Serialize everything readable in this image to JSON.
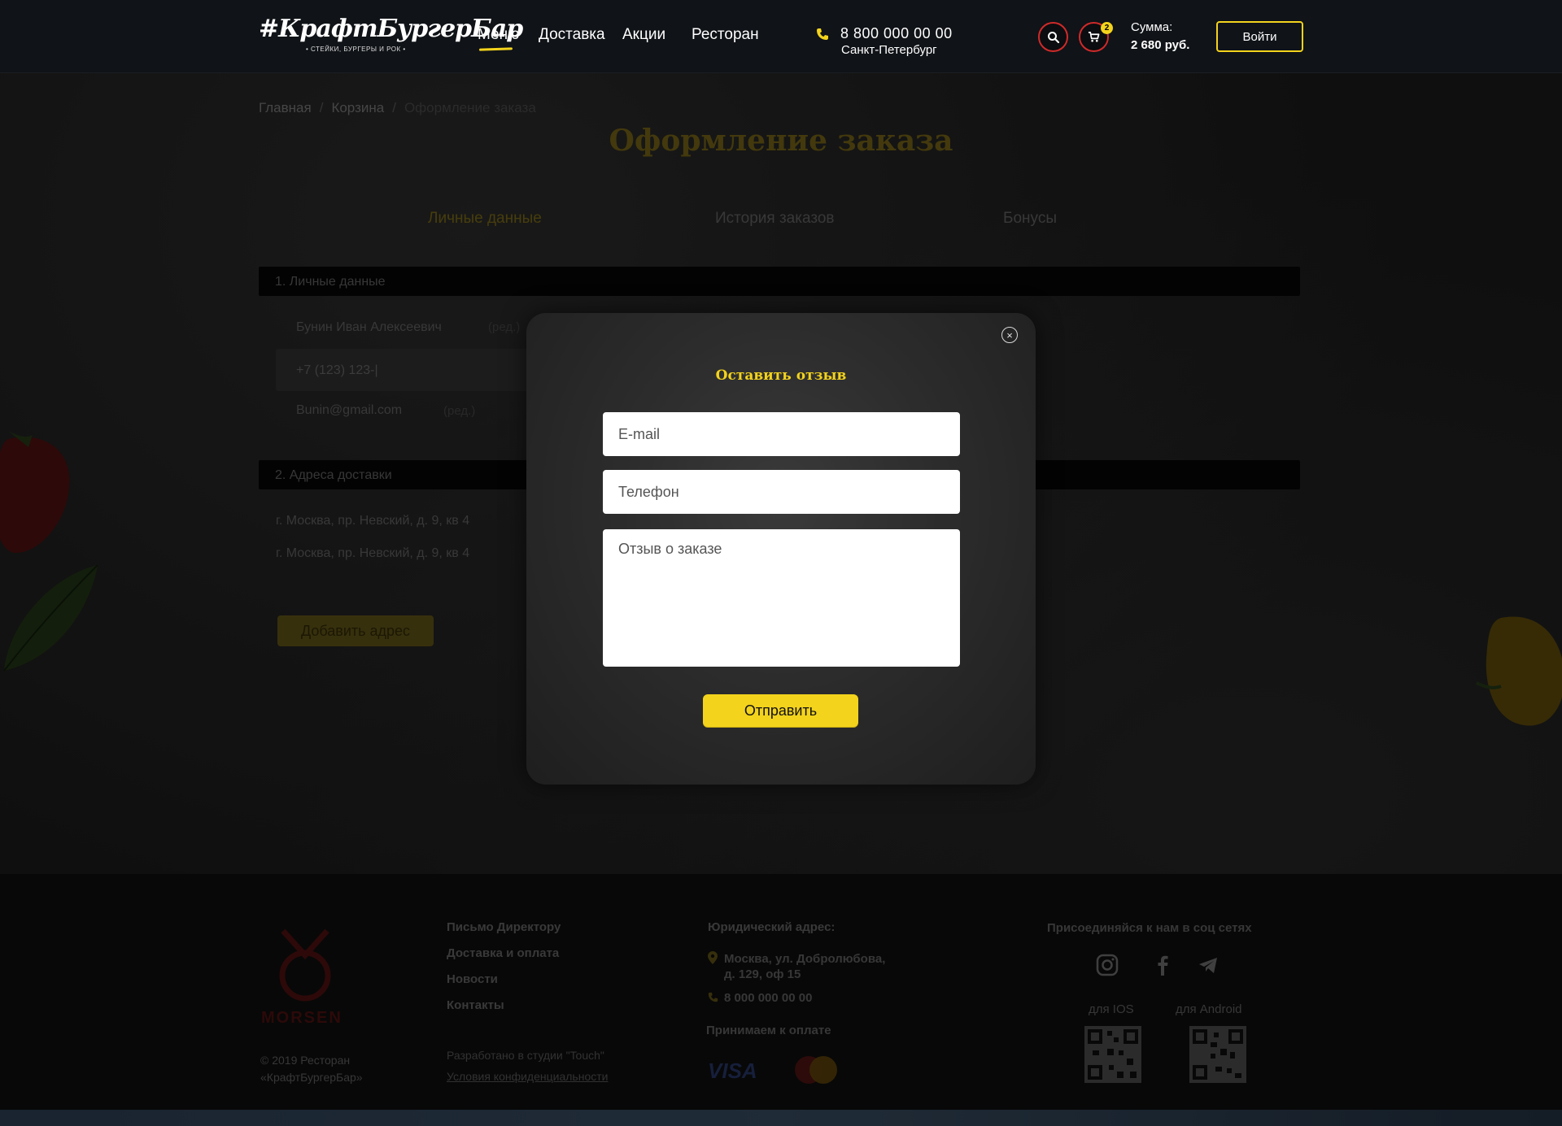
{
  "header": {
    "logo": {
      "main": "#КрафтБургерБар",
      "sub": "• СТЕЙКИ, БУРГЕРЫ И РОК •"
    },
    "nav": [
      {
        "label": "Меню"
      },
      {
        "label": "Доставка"
      },
      {
        "label": "Акции"
      },
      {
        "label": "Ресторан"
      }
    ],
    "phone": "8 800 000 00 00",
    "city": "Санкт-Петербург",
    "cart_count": "2",
    "sum_label": "Сумма:",
    "sum_value": "2 680 руб.",
    "login_label": "Войти"
  },
  "breadcrumb": {
    "home": "Главная",
    "cart": "Корзина",
    "current": "Оформление заказа",
    "separator": "/"
  },
  "page_title": "Оформление заказа",
  "tabs": [
    {
      "label": "Личные данные"
    },
    {
      "label": "История заказов"
    },
    {
      "label": "Бонусы"
    }
  ],
  "personal": {
    "section_title": "1. Личные данные",
    "name": "Бунин Иван Алексеевич",
    "edit_label": "(ред.)",
    "phone_value": "+7 (123) 123-|",
    "email": "Bunin@gmail.com"
  },
  "addresses": {
    "section_title": "2. Адреса доставки",
    "items": [
      "г. Москва, пр. Невский, д. 9, кв 4",
      "г. Москва, пр. Невский, д. 9, кв 4"
    ],
    "add_label": "Добавить адрес"
  },
  "modal": {
    "title": "Оставить отзыв",
    "email_placeholder": "E-mail",
    "phone_placeholder": "Телефон",
    "review_placeholder": "Отзыв о заказе",
    "submit_label": "Отправить",
    "close_glyph": "×"
  },
  "footer": {
    "brand": "MORSEN",
    "copyright_line1": "© 2019 Ресторан",
    "copyright_line2": "«КрафтБургерБар»",
    "links": [
      "Письмо Директору",
      "Доставка и оплата",
      "Новости",
      "Контакты"
    ],
    "studio": "Разработано в студии \"Touch\"",
    "privacy": "Условия конфиденциальности",
    "legal_title": "Юридический адрес:",
    "legal_addr_line1": "Москва, ул. Добролюбова,",
    "legal_addr_line2": "д. 129, оф 15",
    "legal_phone": "8 000 000 00 00",
    "payment_title": "Принимаем к оплате",
    "payment_visa": "VISA",
    "social_title": "Присоединяйся к нам в соц сетях",
    "app_ios": "для IOS",
    "app_android": "для Android"
  },
  "colors": {
    "accent_yellow": "#f3d31c",
    "accent_red": "#d12a2a",
    "modal_bg": "#2c2c2c"
  },
  "icons": [
    "phone-icon",
    "search-icon",
    "cart-icon",
    "close-icon",
    "pin-icon",
    "instagram-icon",
    "facebook-icon",
    "telegram-icon",
    "qr-code-icon"
  ]
}
